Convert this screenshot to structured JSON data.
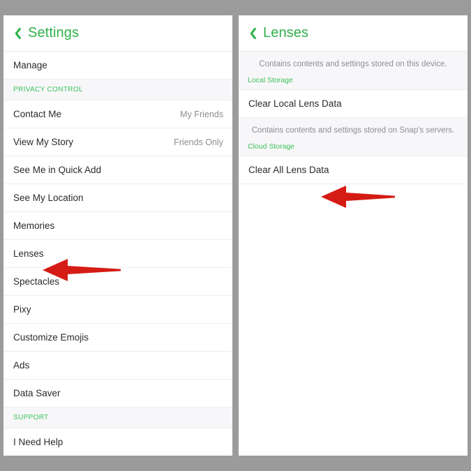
{
  "window": {
    "background_color": "#9b9b9b",
    "accent_green": "#2fb14a",
    "arrow_color": "#d41c14"
  },
  "left_panel": {
    "header": {
      "back_icon": "chevron-left-icon",
      "title": "Settings"
    },
    "rows": [
      {
        "type": "row",
        "label": "Manage",
        "value": ""
      },
      {
        "type": "section",
        "label": "PRIVACY CONTROL",
        "value": ""
      },
      {
        "type": "row",
        "label": "Contact Me",
        "value": "My Friends"
      },
      {
        "type": "row",
        "label": "View My Story",
        "value": "Friends Only"
      },
      {
        "type": "row",
        "label": "See Me in Quick Add",
        "value": ""
      },
      {
        "type": "row",
        "label": "See My Location",
        "value": ""
      },
      {
        "type": "row",
        "label": "Memories",
        "value": ""
      },
      {
        "type": "row",
        "label": "Lenses",
        "value": ""
      },
      {
        "type": "row",
        "label": "Spectacles",
        "value": ""
      },
      {
        "type": "row",
        "label": "Pixy",
        "value": ""
      },
      {
        "type": "row",
        "label": "Customize Emojis",
        "value": ""
      },
      {
        "type": "row",
        "label": "Ads",
        "value": ""
      },
      {
        "type": "row",
        "label": "Data Saver",
        "value": ""
      },
      {
        "type": "section",
        "label": "SUPPORT",
        "value": ""
      },
      {
        "type": "row",
        "label": "I Need Help",
        "value": ""
      }
    ],
    "annotation": {
      "icon": "red-arrow-left-icon",
      "points_at": "Lenses"
    }
  },
  "right_panel": {
    "header": {
      "back_icon": "chevron-left-icon",
      "title": "Lenses"
    },
    "blocks": [
      {
        "description": "Contains contents and settings stored on this device.",
        "tag": "Local Storage",
        "action": "Clear Local Lens Data"
      },
      {
        "description": "Contains contents and settings stored on Snap's servers.",
        "tag": "Cloud Storage",
        "action": "Clear All Lens Data"
      }
    ],
    "annotation": {
      "icon": "red-arrow-left-icon",
      "points_at": "Clear All Lens Data"
    }
  }
}
